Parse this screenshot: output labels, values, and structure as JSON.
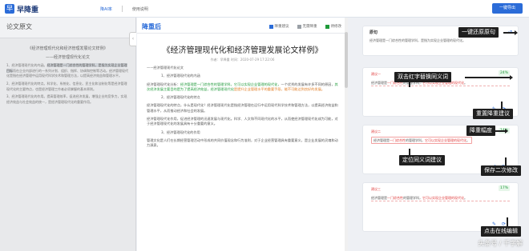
{
  "app": {
    "logo_text": "早降重",
    "logo_mark": "早"
  },
  "topnav": {
    "items": [
      "降AI率",
      "使用说明"
    ]
  },
  "top_button": "一键导出",
  "left": {
    "heading": "论文原文",
    "title_line": "《经济管理现代化和经济管理发展论文样例》",
    "subtitle": "——经济管理现代化论文",
    "para1_pre": "1、经济管理现代化的内涵。",
    "para1_hl": "经济管理是一门综合性的管理学科，是指为实现企业管理目标",
    "para1_post": "而在企业内部进行的一系列计划、组织、指挥、协调和控制等活动。经济管理现代化是指在经济管理中运用现代科学技术和管理方法，以提高经济效益和管理水平。",
    "para2": "2、经济管理现代化的特点。科学化、系统化、信息化、民主化和法制化等是经济管理现代化的主要特点，也是经济管理工作者必须掌握的基本原则。",
    "para3": "3、经济管理现代化的作用。提高管理效率，促进经济发展，增强企业的竞争力，实现经济效益与社会效益的统一，是经济管理现代化的重要作用。"
  },
  "mid": {
    "heading": "降重后",
    "legend": [
      "降重建议",
      "无需降重",
      "待修改"
    ],
    "legend_colors": [
      "#2b6cd8",
      "#9aa0a6",
      "#1f9a3a"
    ],
    "doc_title": "《经济管理现代化和经济管理发展论文样例》",
    "doc_meta": "作者：早降重  时间：2020-07-29 17:22:06",
    "sub": "——经济管理现代化论文",
    "item1": "1、经济管理现代化的内涵",
    "p1_a": "经济管理现代化分析：",
    "p1_b": "经济管理是一门综合性的管理学科，它可以实现企业管理的现代化，",
    "p1_c": "一个优秀的发展有许多不同的原因，",
    "p1_d": "其次经济发展主要目的是为了提高经济效益，经济管理现代化",
    "p1_e": "是提升企业管理水平的重要手段，能不可能达到良好的发展。",
    "item2": "2、经济管理现代化的特点",
    "p2": "经济管理现代化的特点，什么是现代化？经济管理现代化是指经济管理在运行中运用现代科学技术和管理方法，以提高经济效益和管理水平，从而推动经济和社会的发展。",
    "p3": "经济管理现代化作用，促进经济管理的迅速发展与现代化。科学、人文和不同现代化的水平，从而使经济管理现代化成为可能，对于经济管理现代化的发展具有十分重要的意义。",
    "item3": "3、经济管理现代化的作用",
    "p4": "管理文化是人们在长期经营管理活动中形成的共同价值观念和行为准则，对于企业经营管理具有重要意义，是企业发展的灵魂和动力源泉。"
  },
  "right": {
    "orig_label": "原句",
    "orig_text": "经济管理是一门综合性的管理学科，是指为实现企业管理的现代化。",
    "cards": [
      {
        "label": "建议一",
        "pct": "24%",
        "pre": "经济管理是",
        "w1": "一门综合性",
        "mid": "的管理学科，",
        "w2": "它可以实现企业管理的现代化",
        "post": "。"
      },
      {
        "label": "建议二",
        "pct": "14%",
        "pre": "经济管理是",
        "w1": "一门综合性",
        "mid": "的管理学科，",
        "w2": "它可以实现企业管理的现代化",
        "post": "。"
      },
      {
        "label": "建议三",
        "pct": "17%",
        "pre": "经济管理是",
        "w1": "一门综合性",
        "mid": "的管理学科，",
        "w2": "它可以实现企业管理的现代化",
        "post": "。"
      }
    ]
  },
  "annotations": {
    "restore": "一键还原原句",
    "double_click": "双击红字替换同义词",
    "reset": "重置降重建议",
    "range": "降重幅度",
    "locate": "定位同义词建议",
    "save": "保存二次修改",
    "edit": "点击在线编辑"
  },
  "watermark": "头条号 / 千字解"
}
